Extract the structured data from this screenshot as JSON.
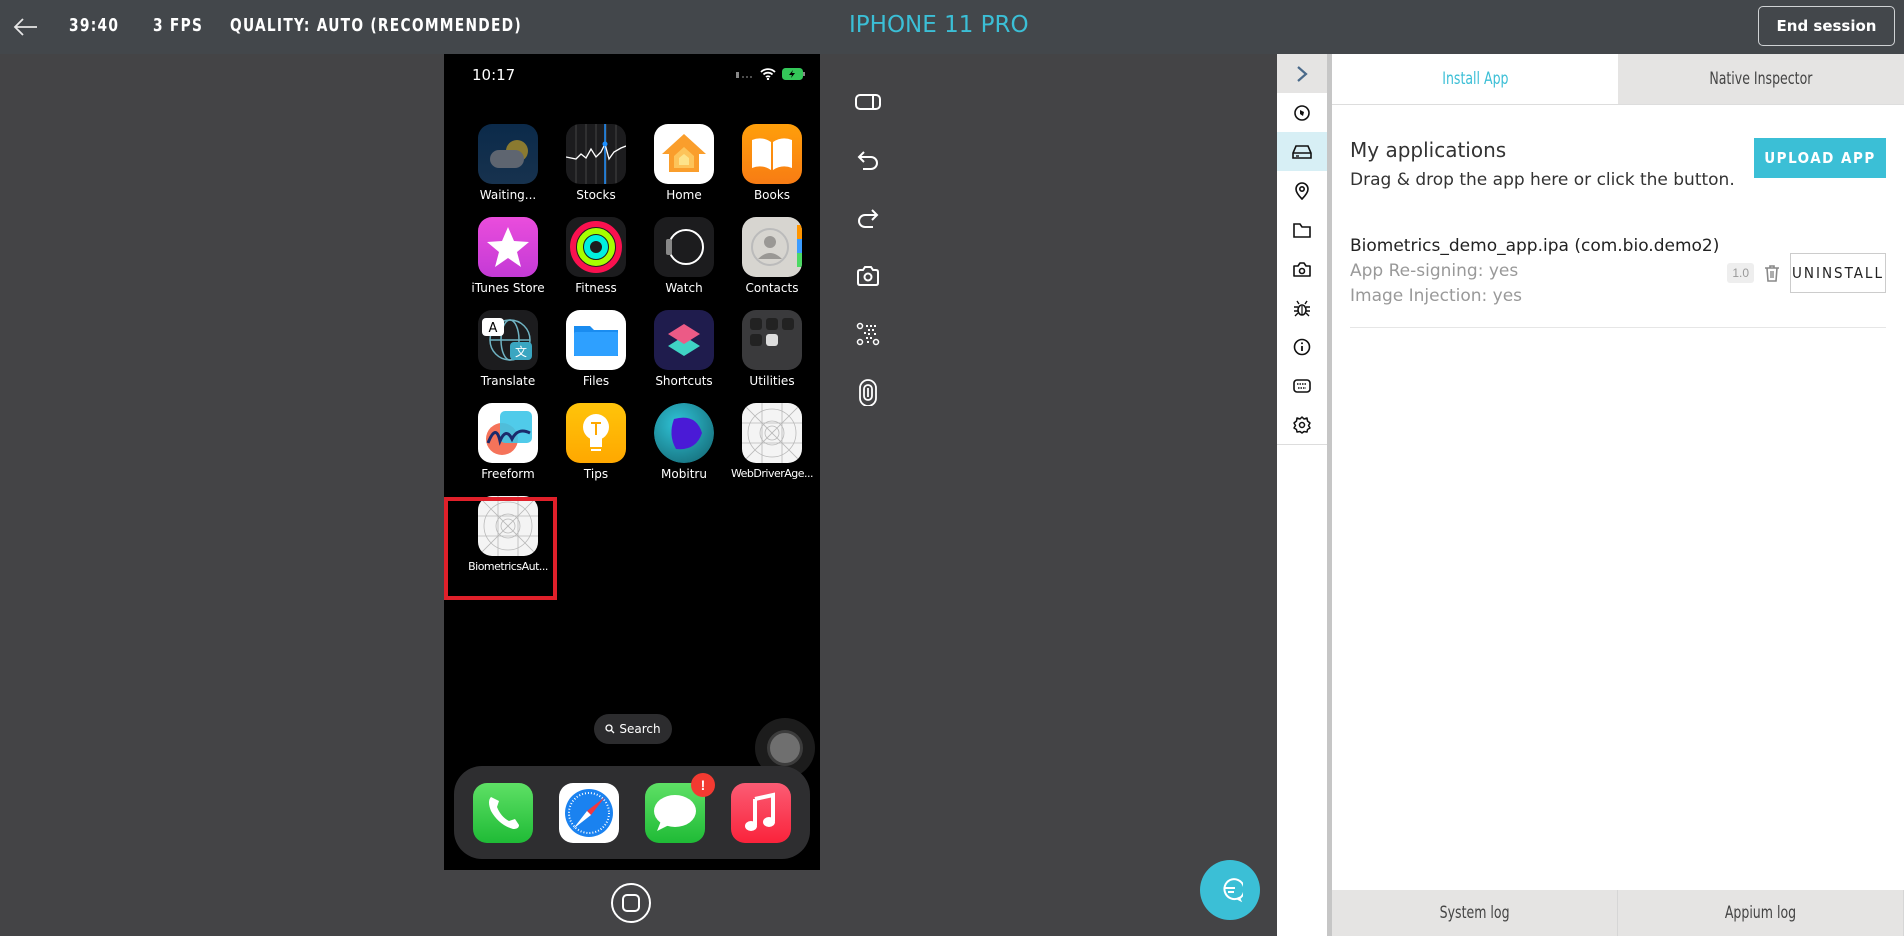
{
  "header": {
    "timer": "39:40",
    "fps": "3 FPS",
    "quality": "QUALITY: AUTO (RECOMMENDED)",
    "device_title": "IPHONE 11 PRO",
    "end_session_label": "End session"
  },
  "colors": {
    "accent": "#3bbfd6",
    "header_bg": "#43474b",
    "main_bg": "#444446",
    "highlight": "#e0202a"
  },
  "phone": {
    "status_time": "10:17",
    "apps": [
      {
        "label": "Waiting...",
        "icon": "weather-icon"
      },
      {
        "label": "Stocks",
        "icon": "stocks-icon"
      },
      {
        "label": "Home",
        "icon": "home-app-icon"
      },
      {
        "label": "Books",
        "icon": "books-icon"
      },
      {
        "label": "iTunes Store",
        "icon": "itunes-store-icon"
      },
      {
        "label": "Fitness",
        "icon": "fitness-icon"
      },
      {
        "label": "Watch",
        "icon": "watch-icon"
      },
      {
        "label": "Contacts",
        "icon": "contacts-icon"
      },
      {
        "label": "Translate",
        "icon": "translate-icon"
      },
      {
        "label": "Files",
        "icon": "files-icon"
      },
      {
        "label": "Shortcuts",
        "icon": "shortcuts-icon"
      },
      {
        "label": "Utilities",
        "icon": "utilities-folder-icon"
      },
      {
        "label": "Freeform",
        "icon": "freeform-icon"
      },
      {
        "label": "Tips",
        "icon": "tips-icon"
      },
      {
        "label": "Mobitru",
        "icon": "mobitru-icon"
      },
      {
        "label": "WebDriverAge...",
        "icon": "placeholder-app-icon"
      },
      {
        "label": "BiometricsAut...",
        "icon": "placeholder-app-icon"
      }
    ],
    "search_label": "Search",
    "dock": [
      {
        "name": "Phone",
        "icon": "phone-icon"
      },
      {
        "name": "Safari",
        "icon": "safari-icon"
      },
      {
        "name": "Messages",
        "icon": "messages-icon",
        "badge": "!"
      },
      {
        "name": "Music",
        "icon": "music-icon"
      }
    ]
  },
  "toolbar": [
    "rotate-icon",
    "undo-icon",
    "redo-icon",
    "screenshot-icon",
    "qr-code-icon",
    "fingerprint-icon"
  ],
  "rail": [
    "collapse-icon",
    "speed-icon",
    "install-app-icon",
    "location-icon",
    "folder-icon",
    "camera-icon",
    "bug-icon",
    "info-icon",
    "keyboard-icon",
    "settings-icon"
  ],
  "panel": {
    "tabs": [
      {
        "label": "Install App",
        "active": true
      },
      {
        "label": "Native Inspector",
        "active": false
      }
    ],
    "section_title": "My applications",
    "section_subtitle": "Drag & drop the app here or click the button.",
    "upload_label": "UPLOAD APP",
    "apps": [
      {
        "name": "Biometrics_demo_app.ipa (com.bio.demo2)",
        "resigning": "App Re-signing: yes",
        "injection": "Image Injection: yes",
        "version": "1.0",
        "uninstall_label": "UNINSTALL"
      }
    ],
    "log_tabs": [
      "System log",
      "Appium log"
    ]
  }
}
